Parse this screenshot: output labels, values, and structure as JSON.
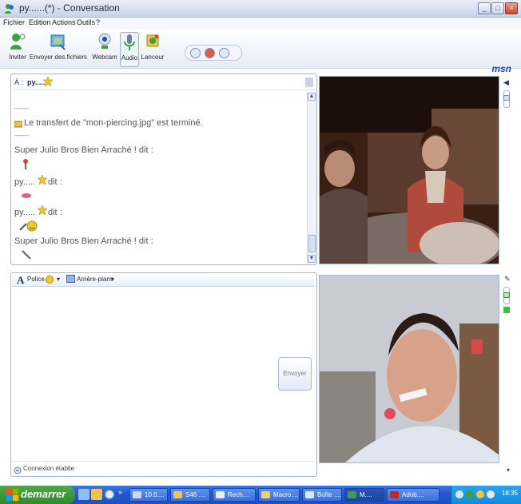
{
  "window": {
    "title": "py......(*) - Conversation"
  },
  "menu": [
    "Fichier",
    "Edition",
    "Actions",
    "Outils",
    "?"
  ],
  "toolbar": {
    "buttons": [
      "Inviter",
      "Envoyer des fichiers",
      "Webcam",
      "Audio",
      "Lanceur"
    ],
    "brand": "msn"
  },
  "conversation": {
    "to_label": "À :",
    "to_name": "py.....",
    "lines": {
      "sep1": "——",
      "transfer": "Le transfert de \"mon-piercing.jpg\" est terminé.",
      "sep2": "——",
      "msg1": "Super Julio Bros Bien Arraché ! dit :",
      "msg2_name": "py.....",
      "msg2_says": "dit :",
      "msg3_name": "py.....",
      "msg3_says": "dit :",
      "msg4": "Super Julio Bros Bien Arraché ! dit :"
    }
  },
  "compose": {
    "font_label": "Police",
    "background_label": "Arrière-plans",
    "send_label": "Envoyer",
    "status": "Connexion établie"
  },
  "taskbar": {
    "start": "demarrer",
    "tasks": [
      "10.0....",
      "S46 ....",
      "Rech....",
      "Macro....",
      "Boîte ....",
      "M....",
      "Adob...."
    ],
    "time": "18:35"
  },
  "colors": {
    "accent": "#1f4fa3",
    "taskbar": "#245ad0",
    "start_button": "#2e8a2a"
  }
}
